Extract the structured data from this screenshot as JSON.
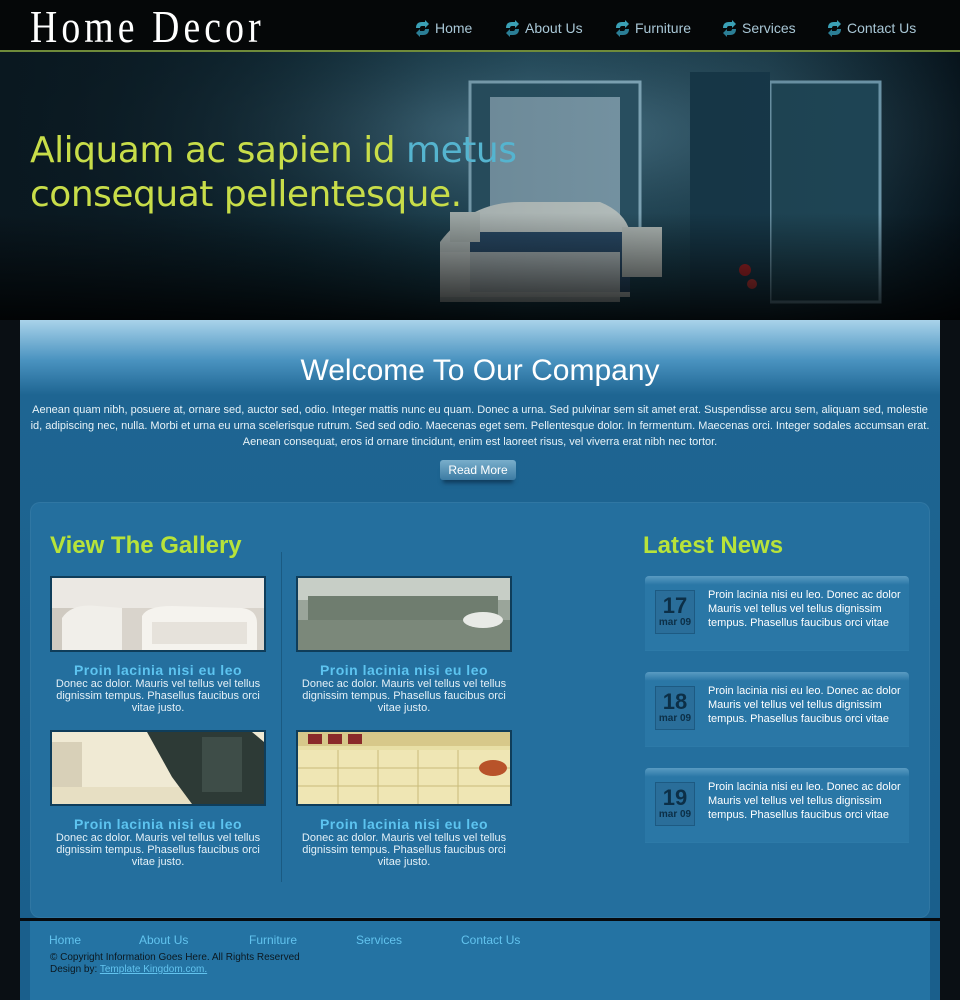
{
  "header": {
    "logo": "Home Decor",
    "nav": [
      "Home",
      "About Us",
      "Furniture",
      "Services",
      "Contact Us"
    ]
  },
  "hero": {
    "line1_a": "Aliquam ac sapien id ",
    "line1_b": "metus",
    "line2_a": "consequat pellentesque."
  },
  "welcome": {
    "title": "Welcome To Our Company",
    "text": "Aenean quam nibh, posuere at, ornare sed, auctor sed, odio. Integer mattis nunc eu quam. Donec a urna. Sed pulvinar sem sit amet erat. Suspendisse arcu sem, aliquam sed, molestie id, adipiscing nec, nulla. Morbi et urna eu urna scelerisque rutrum. Sed sed odio. Maecenas eget sem. Pellentesque dolor. In fermentum. Maecenas orci. Integer sodales accumsan erat. Aenean consequat, eros id ornare tincidunt, enim est laoreet risus, vel viverra erat nibh nec tortor.",
    "button": "Read More"
  },
  "gallery": {
    "title": "View The Gallery",
    "items": [
      {
        "title": "Proin lacinia nisi eu leo",
        "text": "Donec ac dolor. Mauris vel tellus vel tellus dignissim tempus. Phasellus faucibus orci vitae justo."
      },
      {
        "title": "Proin lacinia nisi eu leo",
        "text": "Donec ac dolor. Mauris vel tellus vel tellus dignissim tempus. Phasellus faucibus orci vitae justo."
      },
      {
        "title": "Proin lacinia nisi eu leo",
        "text": "Donec ac dolor. Mauris vel tellus vel tellus dignissim tempus. Phasellus faucibus orci vitae justo."
      },
      {
        "title": "Proin lacinia nisi eu leo",
        "text": "Donec ac dolor. Mauris vel tellus vel tellus dignissim tempus. Phasellus faucibus orci vitae justo."
      }
    ]
  },
  "news": {
    "title": "Latest News",
    "items": [
      {
        "day": "17",
        "month": "mar 09",
        "text": "Proin lacinia nisi eu leo. Donec ac dolor Mauris vel tellus vel tellus dignissim tempus. Phasellus faucibus orci vitae"
      },
      {
        "day": "18",
        "month": "mar 09",
        "text": "Proin lacinia nisi eu leo. Donec ac dolor Mauris vel tellus vel tellus dignissim tempus. Phasellus faucibus orci vitae"
      },
      {
        "day": "19",
        "month": "mar 09",
        "text": "Proin lacinia nisi eu leo. Donec ac dolor Mauris vel tellus vel tellus dignissim tempus. Phasellus faucibus orci vitae"
      }
    ]
  },
  "footer": {
    "links": [
      "Home",
      "About Us",
      "Furniture",
      "Services",
      "Contact Us"
    ],
    "copyright": "© Copyright Information Goes Here. All Rights Reserved",
    "design_label": "Design by:",
    "design_link": "Template Kingdom.com."
  },
  "colors": {
    "accent_green": "#b8e33a",
    "link_blue": "#62c3ee",
    "panel_blue": "#246f9e"
  }
}
